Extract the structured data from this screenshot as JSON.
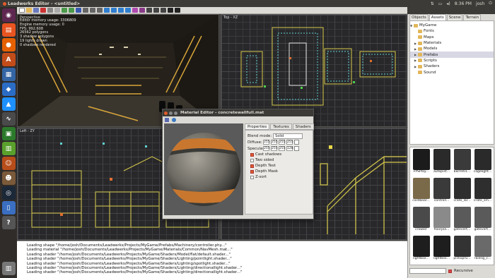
{
  "window": {
    "title": "Leadwerks Editor - <untitled>"
  },
  "system_tray": {
    "time": "8:36 PM",
    "user": "josh"
  },
  "viewports": {
    "perspective": {
      "label": "Perspective",
      "stats": [
        "Editor memory usage: 3306809",
        "Engine memory usage: 0",
        "FPS: 992.608",
        "26562 polygons",
        "3 shadow polygons",
        "19 lights drawn",
        "0 shadows rendered"
      ]
    },
    "top": {
      "label": "Top - XZ"
    },
    "left": {
      "label": "Left - ZY"
    }
  },
  "console": {
    "lines": [
      "Loading shape \"/home/josh/Documents/Leadwerks/Projects/MyGame/Prefabs/Machinery/controller.phy...\"",
      "Loading material \"/home/josh/Documents/Leadwerks/Projects/MyGame/Materials/Common/NavMesh.mat...\"",
      "Loading shader \"/home/josh/Documents/Leadwerks/Projects/MyGame/Shaders/Model/flat/default.shader...\"",
      "Loading shader \"/home/josh/Documents/Leadwerks/Projects/MyGame/Shaders/Lighting/pointlight.shader...\"",
      "Loading shader \"/home/josh/Documents/Leadwerks/Projects/MyGame/Shaders/Lighting/spotlight.shader...\"",
      "Loading shader \"/home/josh/Documents/Leadwerks/Projects/MyGame/Shaders/Lighting/directionallight.shader...\"",
      "Loading shader \"/home/josh/Documents/Leadwerks/Projects/MyGame/Shaders/Lighting/directionallight.shader...\""
    ]
  },
  "side_panel": {
    "tabs": [
      "Objects",
      "Assets",
      "Scene",
      "Terrain"
    ],
    "active_tab": "Assets",
    "tree": {
      "root": "MyGame",
      "folders": [
        "Fonts",
        "Maps",
        "Materials",
        "Models",
        "Prefabs",
        "Scripts",
        "Shaders",
        "Sound"
      ],
      "selected": "Prefabs"
    },
    "assets": [
      {
        "label": "FPSPlay...",
        "color": "#1b1b1b"
      },
      {
        "label": "autopist...",
        "color": "#2a2a2a"
      },
      {
        "label": "barrel01...",
        "color": "#3a3a3a"
      },
      {
        "label": "cagelight...",
        "color": "#2a2a2a"
      },
      {
        "label": "cardboar...",
        "color": "#7a6a4a"
      },
      {
        "label": "controll...",
        "color": "#3a3a3a"
      },
      {
        "label": "crate_lar...",
        "color": "#2e2e2e"
      },
      {
        "label": "crate_sm...",
        "color": "#2e2e2e"
      },
      {
        "label": "crawler",
        "color": "#4a4a4a"
      },
      {
        "label": "floorpla...",
        "color": "#8a8a8a"
      },
      {
        "label": "gatevert...",
        "color": "#5a5a5a"
      },
      {
        "label": "gatevert...",
        "color": "#5a5a5a"
      },
      {
        "label": "lightbox...",
        "color": "#1e1e1e"
      },
      {
        "label": "lightbox...",
        "color": "#1e1e1e"
      },
      {
        "label": "pickupru...",
        "color": "#333333"
      },
      {
        "label": "railing_c...",
        "color": "#6a6a6a"
      }
    ],
    "recursive_label": "Recursive"
  },
  "material_editor": {
    "title": "Material Editor - concretewallfull.mat",
    "tabs": [
      "Properties",
      "Textures",
      "Shaders"
    ],
    "active_tab": "Properties",
    "blend_mode_label": "Blend mode:",
    "blend_mode_value": "Solid",
    "diffuse_label": "Diffuse:",
    "diffuse_values": [
      "255",
      "255",
      "255",
      "255"
    ],
    "specular_label": "Specular:",
    "specular_values": [
      "255",
      "255",
      "255",
      "128"
    ],
    "checkboxes": [
      {
        "label": "Cast shadows",
        "checked": true
      },
      {
        "label": "Two sided",
        "checked": false
      },
      {
        "label": "Depth Test",
        "checked": true
      },
      {
        "label": "Depth Mask",
        "checked": true
      },
      {
        "label": "Z-sort",
        "checked": false
      }
    ]
  },
  "colors": {
    "accent": "#f07746",
    "ubuntu_bar": "#3c3b37",
    "panel": "#dcdad5",
    "grid": "#28282a"
  }
}
